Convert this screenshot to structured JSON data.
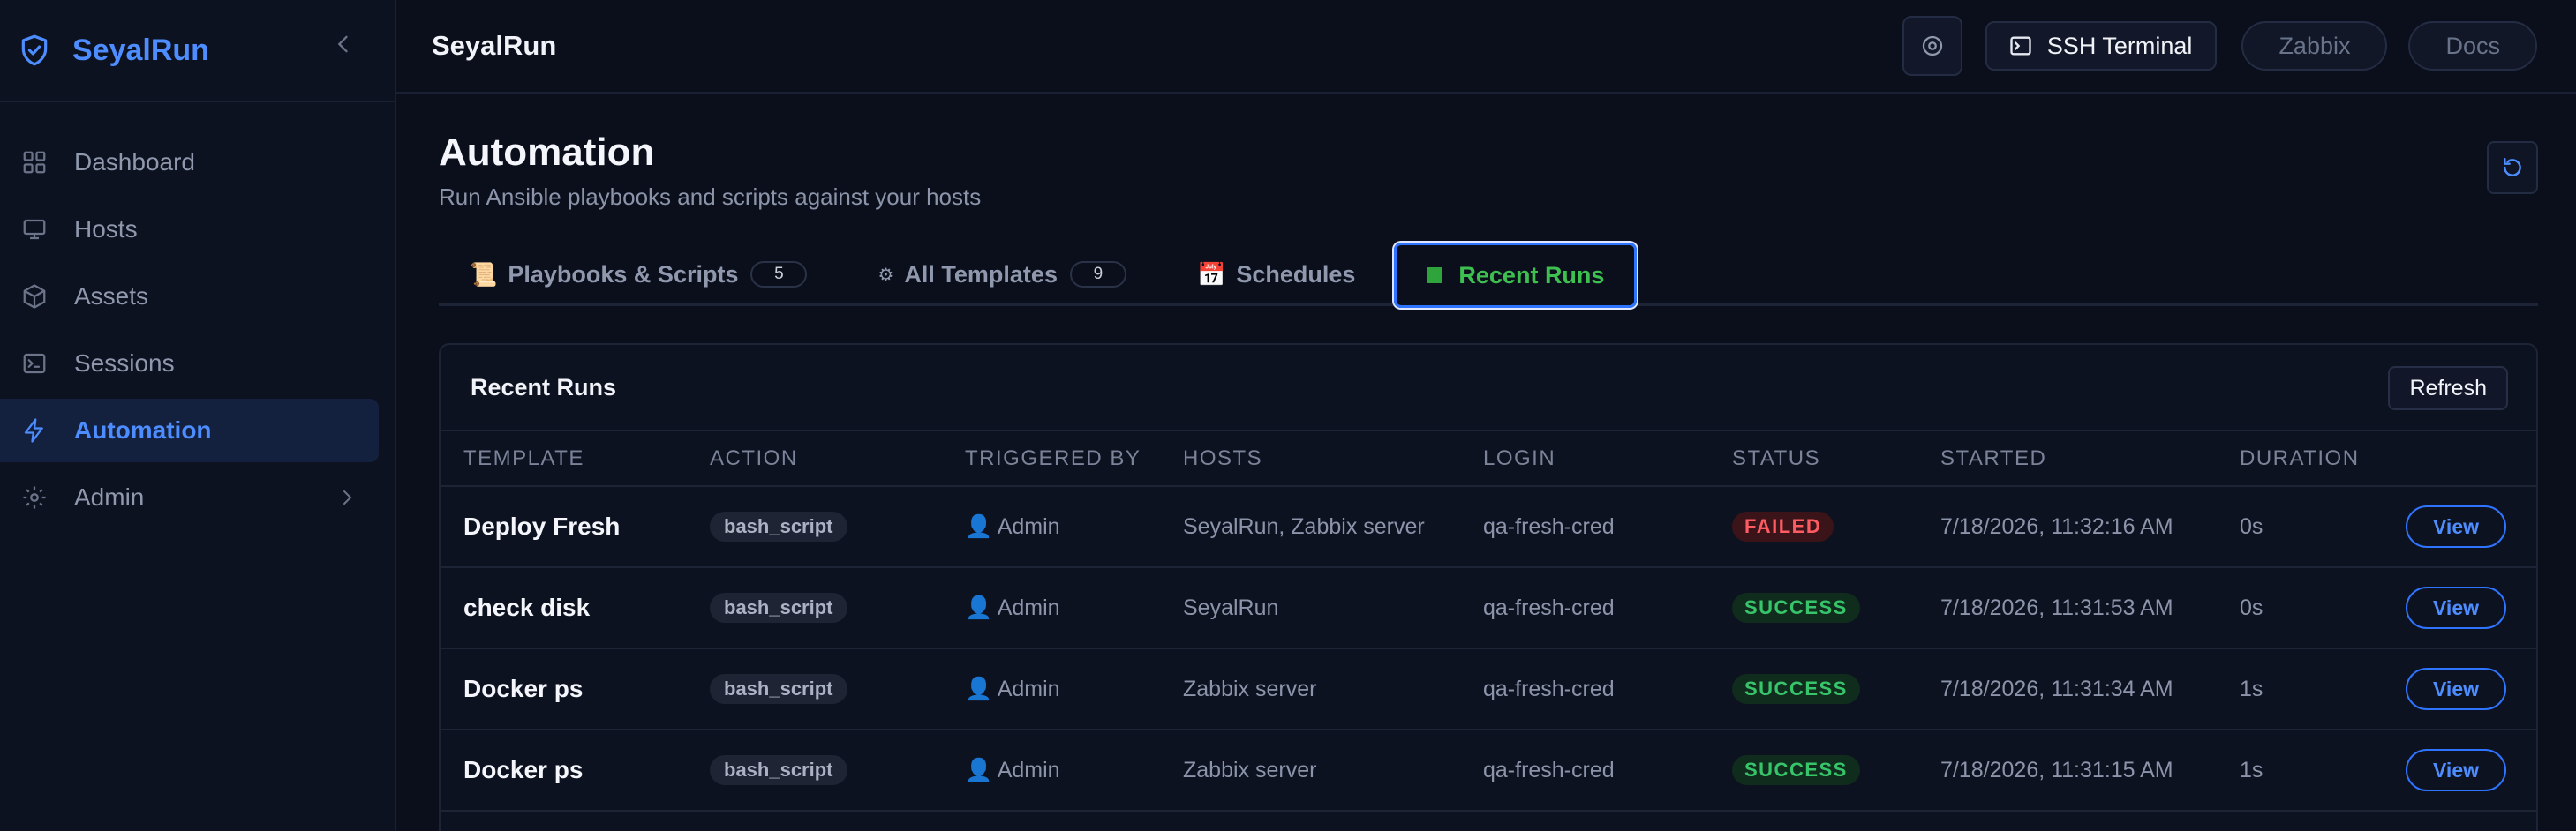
{
  "app": {
    "name": "SeyalRun",
    "accent": "#4d8dff"
  },
  "sidebar": {
    "items": [
      {
        "label": "Dashboard",
        "icon": "grid-icon"
      },
      {
        "label": "Hosts",
        "icon": "monitor-icon"
      },
      {
        "label": "Assets",
        "icon": "box-icon"
      },
      {
        "label": "Sessions",
        "icon": "terminal-icon"
      },
      {
        "label": "Automation",
        "icon": "lightning-icon",
        "active": true
      },
      {
        "label": "Admin",
        "icon": "gear-icon",
        "has_submenu": true
      }
    ]
  },
  "topbar": {
    "title": "SeyalRun",
    "ssh_label": "SSH Terminal",
    "zabbix_label": "Zabbix",
    "docs_label": "Docs"
  },
  "page": {
    "title": "Automation",
    "subtitle": "Run Ansible playbooks and scripts against your hosts"
  },
  "tabs": [
    {
      "emoji": "📜",
      "label": "Playbooks & Scripts",
      "count": "5"
    },
    {
      "emoji": "⚙",
      "label": "All Templates",
      "count": "9"
    },
    {
      "emoji": "📅",
      "label": "Schedules"
    },
    {
      "label": "Recent Runs",
      "active": true
    }
  ],
  "card": {
    "title": "Recent Runs",
    "refresh_label": "Refresh",
    "columns": [
      "TEMPLATE",
      "ACTION",
      "TRIGGERED BY",
      "HOSTS",
      "LOGIN",
      "STATUS",
      "STARTED",
      "DURATION"
    ],
    "rows": [
      {
        "template": "Deploy Fresh",
        "action": "bash_script",
        "triggered_by": "👤 Admin",
        "hosts": "SeyalRun, Zabbix server",
        "login": "qa-fresh-cred",
        "status": "FAILED",
        "started": "7/18/2026, 11:32:16 AM",
        "duration": "0s",
        "view": "View"
      },
      {
        "template": "check disk",
        "action": "bash_script",
        "triggered_by": "👤 Admin",
        "hosts": "SeyalRun",
        "login": "qa-fresh-cred",
        "status": "SUCCESS",
        "started": "7/18/2026, 11:31:53 AM",
        "duration": "0s",
        "view": "View"
      },
      {
        "template": "Docker ps",
        "action": "bash_script",
        "triggered_by": "👤 Admin",
        "hosts": "Zabbix server",
        "login": "qa-fresh-cred",
        "status": "SUCCESS",
        "started": "7/18/2026, 11:31:34 AM",
        "duration": "1s",
        "view": "View"
      },
      {
        "template": "Docker ps",
        "action": "bash_script",
        "triggered_by": "👤 Admin",
        "hosts": "Zabbix server",
        "login": "qa-fresh-cred",
        "status": "SUCCESS",
        "started": "7/18/2026, 11:31:15 AM",
        "duration": "1s",
        "view": "View"
      }
    ]
  },
  "colors": {
    "failed": "#ff5b62",
    "success": "#38c46a",
    "active_tab": "#3dc04f",
    "background": "#0b0f1c"
  }
}
